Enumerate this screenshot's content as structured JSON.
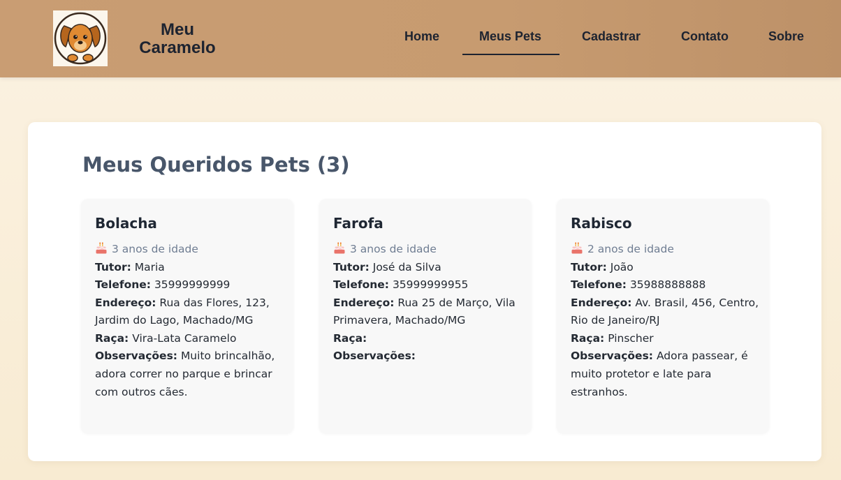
{
  "header": {
    "brand": "Meu Caramelo",
    "logo_icon": "dog-face-icon",
    "nav": [
      {
        "label": "Home",
        "active": false
      },
      {
        "label": "Meus Pets",
        "active": true
      },
      {
        "label": "Cadastrar",
        "active": false
      },
      {
        "label": "Contato",
        "active": false
      },
      {
        "label": "Sobre",
        "active": false
      }
    ]
  },
  "main": {
    "title": "Meus Queridos Pets (3)",
    "labels": {
      "tutor": "Tutor:",
      "phone": "Telefone:",
      "address": "Endereço:",
      "breed": "Raça:",
      "notes": "Observações:"
    },
    "age_icon": "birthday-cake-icon",
    "pets": [
      {
        "name": "Bolacha",
        "age": "3 anos de idade",
        "tutor": "Maria",
        "phone": "35999999999",
        "address": "Rua das Flores, 123, Jardim do Lago, Machado/MG",
        "breed": "Vira-Lata Caramelo",
        "notes": "Muito brincalhão, adora correr no parque e brincar com outros cães."
      },
      {
        "name": "Farofa",
        "age": "3 anos de idade",
        "tutor": "José da Silva",
        "phone": "35999999955",
        "address": "Rua 25 de Março, Vila Primavera, Machado/MG",
        "breed": "",
        "notes": ""
      },
      {
        "name": "Rabisco",
        "age": "2 anos de idade",
        "tutor": "João",
        "phone": "35988888888",
        "address": "Av. Brasil, 456, Centro, Rio de Janeiro/RJ",
        "breed": "Pinscher",
        "notes": "Adora passear, é muito protetor e late para estranhos."
      }
    ]
  },
  "colors": {
    "header_bg": "#c99d73",
    "page_bg": "#fbf2e2",
    "title": "#48566a",
    "age_text": "#6f7d92"
  }
}
